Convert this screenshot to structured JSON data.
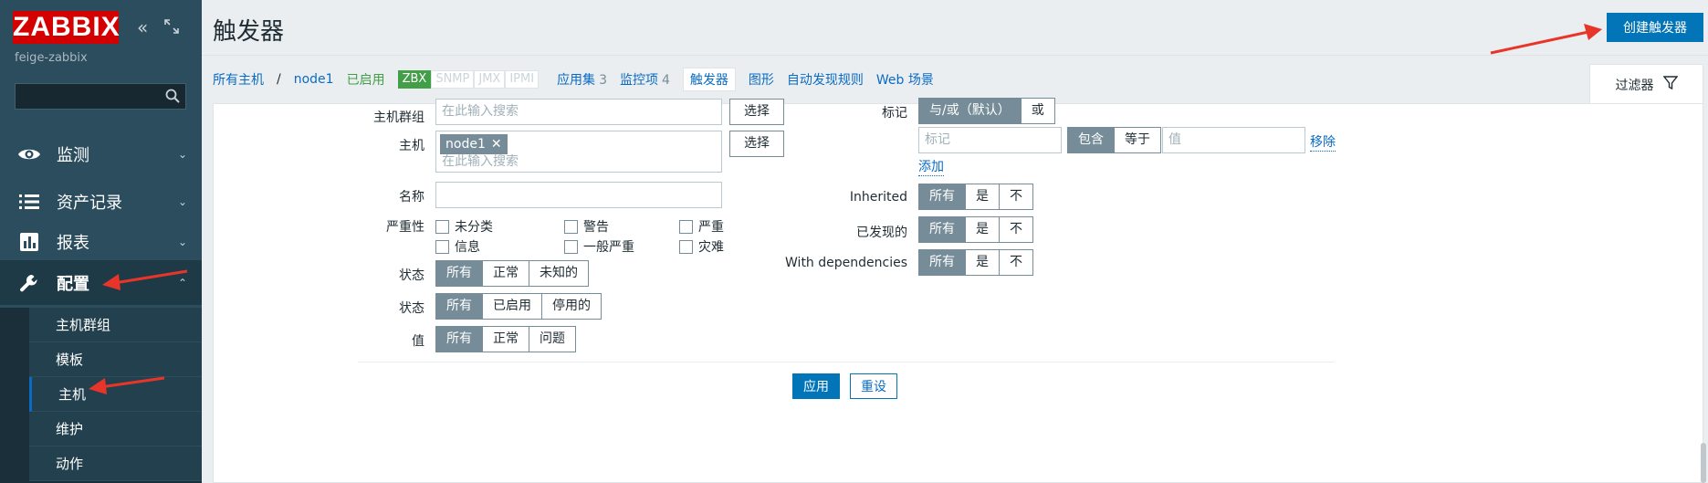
{
  "sidebar": {
    "logo": "ZABBIX",
    "collapse_icon": "double-chevron-left-icon",
    "expand_icon": "fullscreen-icon",
    "server_name": "feige-zabbix",
    "search_placeholder": "",
    "menu": [
      {
        "label": "监测",
        "icon": "eye-icon"
      },
      {
        "label": "资产记录",
        "icon": "list-icon"
      },
      {
        "label": "报表",
        "icon": "bar-chart-icon"
      },
      {
        "label": "配置",
        "icon": "wrench-icon"
      }
    ],
    "submenu": [
      "主机群组",
      "模板",
      "主机",
      "维护",
      "动作"
    ]
  },
  "header": {
    "title": "触发器",
    "create_button": "创建触发器"
  },
  "host_nav": {
    "all_hosts": "所有主机",
    "separator": "/",
    "host": "node1",
    "status": "已启用",
    "protocols": [
      "ZBX",
      "SNMP",
      "JMX",
      "IPMI"
    ],
    "apps_label": "应用集",
    "apps_count": "3",
    "items_label": "监控项",
    "items_count": "4",
    "triggers": "触发器",
    "graphs": "图形",
    "discovery": "自动发现规则",
    "web": "Web 场景"
  },
  "filter": {
    "tab_label": "过滤器",
    "host_group_label": "主机群组",
    "host_group_placeholder": "在此输入搜索",
    "select_button": "选择",
    "host_label": "主机",
    "host_tag": "node1",
    "host_placeholder": "在此输入搜索",
    "name_label": "名称",
    "severity_label": "严重性",
    "severities": [
      "未分类",
      "警告",
      "严重",
      "信息",
      "一般严重",
      "灾难"
    ],
    "state_label": "状态",
    "state_options": [
      "所有",
      "正常",
      "未知的"
    ],
    "status_label": "状态",
    "status_options": [
      "所有",
      "已启用",
      "停用的"
    ],
    "value_label": "值",
    "value_options": [
      "所有",
      "正常",
      "问题"
    ],
    "tags_label": "标记",
    "tags_mode": [
      "与/或（默认）",
      "或"
    ],
    "tag_placeholder": "标记",
    "tag_ops": [
      "包含",
      "等于"
    ],
    "value_placeholder": "值",
    "remove_link": "移除",
    "add_link": "添加",
    "inherited_label": "Inherited",
    "discovered_label": "已发现的",
    "dependencies_label": "With dependencies",
    "tri_options": [
      "所有",
      "是",
      "不"
    ],
    "apply_button": "应用",
    "reset_button": "重设"
  },
  "colors": {
    "sidebar_bg": "#2b4d5e",
    "accent": "#0275b8",
    "annotation_arrow": "#e8352a"
  }
}
